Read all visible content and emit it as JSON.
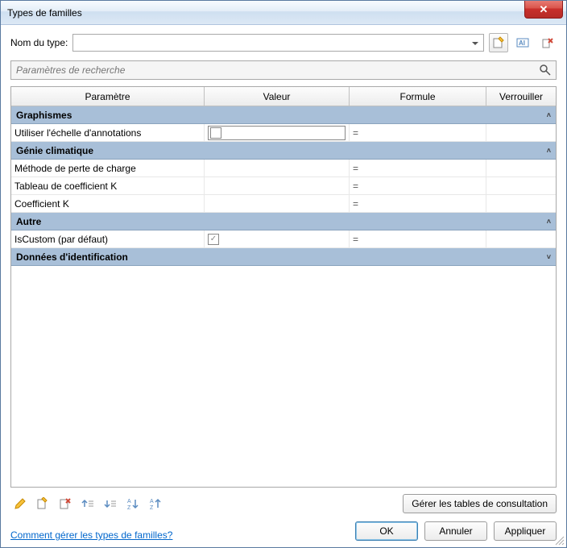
{
  "titlebar": {
    "title": "Types de familles"
  },
  "typename": {
    "label": "Nom du type:",
    "value": ""
  },
  "typename_buttons": {
    "new_type": "new-type-icon",
    "rename_type": "rename-type-icon",
    "delete_type": "delete-type-icon"
  },
  "search": {
    "placeholder": "Paramètres de recherche"
  },
  "columns": {
    "param": "Paramètre",
    "value": "Valeur",
    "formula": "Formule",
    "lock": "Verrouiller"
  },
  "groups": [
    {
      "name": "Graphismes",
      "collapsed": false,
      "rows": [
        {
          "param": "Utiliser l'échelle d'annotations",
          "value_type": "checkbox",
          "checked": false,
          "has_box": true,
          "formula": "="
        }
      ]
    },
    {
      "name": "Génie climatique",
      "collapsed": false,
      "rows": [
        {
          "param": "Méthode de perte de charge",
          "value_type": "text",
          "value": "",
          "formula": "="
        },
        {
          "param": "Tableau de coefficient K",
          "value_type": "text",
          "value": "",
          "formula": "="
        },
        {
          "param": "Coefficient K",
          "value_type": "text",
          "value": "",
          "formula": "="
        }
      ]
    },
    {
      "name": "Autre",
      "collapsed": false,
      "rows": [
        {
          "param": "IsCustom (par défaut)",
          "value_type": "checkbox",
          "checked": true,
          "has_box": false,
          "formula": "="
        }
      ]
    },
    {
      "name": "Données d'identification",
      "collapsed": true,
      "rows": []
    }
  ],
  "param_toolbar": {
    "icons": [
      "edit-icon",
      "new-param-icon",
      "delete-param-icon",
      "move-up-icon",
      "move-down-icon",
      "sort-asc-icon",
      "sort-desc-icon"
    ]
  },
  "lookup_btn": "Gérer les tables de consultation",
  "help_link": "Comment gérer les types de familles?",
  "footer": {
    "ok": "OK",
    "cancel": "Annuler",
    "apply": "Appliquer"
  }
}
